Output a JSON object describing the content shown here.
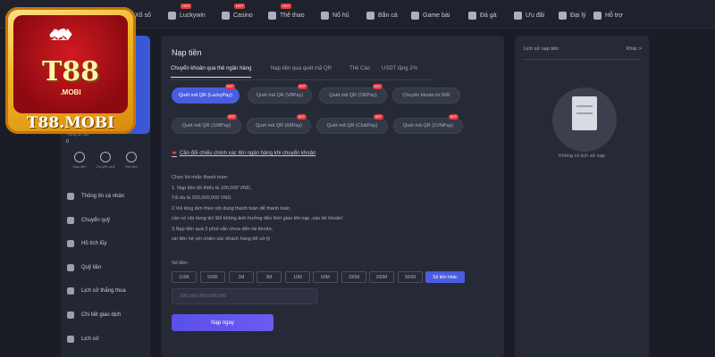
{
  "nav": [
    {
      "label": "Xổ số",
      "icon": "lottery-icon",
      "hot": ""
    },
    {
      "label": "Luckywin",
      "icon": "lucky-icon",
      "hot": "HOT"
    },
    {
      "label": "Casino",
      "icon": "casino-icon",
      "hot": "HOT"
    },
    {
      "label": "Thể thao",
      "icon": "sports-icon",
      "hot": "HOT"
    },
    {
      "label": "Nổ hũ",
      "icon": "slots-icon",
      "hot": ""
    },
    {
      "label": "Bắn cá",
      "icon": "fishing-icon",
      "hot": ""
    },
    {
      "label": "Game bài",
      "icon": "cards-icon",
      "hot": ""
    },
    {
      "label": "Đá gà",
      "icon": "cockfight-icon",
      "hot": ""
    },
    {
      "label": "Ưu đãi",
      "icon": "gift-icon",
      "hot": ""
    },
    {
      "label": "Đại lý",
      "icon": "agent-icon",
      "hot": ""
    },
    {
      "label": "Hỗ trợ",
      "icon": "support-icon",
      "hot": ""
    }
  ],
  "logo": {
    "big": "T88",
    "small": ".MOBI",
    "name": "T88.MOBI"
  },
  "sidebar": {
    "balance_label": "Tổng số dư",
    "balance_value": "0",
    "quick": [
      {
        "label": "Nạp tiền",
        "icon": "deposit-icon"
      },
      {
        "label": "Chuyển quỹ",
        "icon": "transfer-icon"
      },
      {
        "label": "Rút tiền",
        "icon": "withdraw-icon"
      }
    ],
    "menu": [
      {
        "label": "Thông tin cá nhân",
        "icon": "user-icon"
      },
      {
        "label": "Chuyển quỹ",
        "icon": "transfer-icon"
      },
      {
        "label": "Hồ tích lũy",
        "icon": "piggy-icon"
      },
      {
        "label": "Quỹ tiền",
        "icon": "wallet-icon"
      },
      {
        "label": "Lịch sử thắng thua",
        "icon": "history-icon"
      },
      {
        "label": "Chi tiết giao dịch",
        "icon": "receipt-icon"
      },
      {
        "label": "Lịch sử",
        "icon": "clock-icon"
      }
    ]
  },
  "main": {
    "title": "Nạp tiền",
    "tabs": [
      "Chuyển khoản qua thẻ ngân hàng",
      "Nạp tiền qua quét mã QR",
      "Thẻ Cào",
      "USDT tặng 2%"
    ],
    "methods": [
      {
        "label": "Quét mã QR (LuckyPay)",
        "tag": "HOT"
      },
      {
        "label": "Quét mã QR (V8Pay)",
        "tag": "HOT"
      },
      {
        "label": "Quét mã QR (OKPay)",
        "tag": "HOT"
      },
      {
        "label": "Chuyển khoản từ 50K",
        "tag": ""
      },
      {
        "label": "Quét mã QR (168Pay)",
        "tag": "HOT"
      },
      {
        "label": "Quét mã QR (68Pay)",
        "tag": "HOT"
      },
      {
        "label": "Quét mã QR (ClubPay)",
        "tag": "HOT"
      },
      {
        "label": "Quét mã QR (1VNPay)",
        "tag": "HOT"
      }
    ],
    "notice": "Cần đối chiếu chính xác tên ngân hàng khi chuyển khoản",
    "notes": [
      "Chọn lời nhắc thanh toán:",
      "1. Nạp tiền tối thiểu là 100,000 VND,",
      "Tối đa là 300,000,000 VND.",
      "2.Vui lòng làm theo nội dung thanh toán để thanh toán,",
      "cần có nội dung tin! Để không ảnh hưởng đến thời gian khi nạp ,vào tài khoản!",
      "3.Nạp tiền quá 3 phút vẫn chưa đến tài khoản,",
      "xin liên hệ với chăm sóc khách hàng để xử lý"
    ],
    "amount_label": "Số tiền:",
    "amounts": [
      "100K",
      "500K",
      "1M",
      "3M",
      "10M",
      "50M",
      "100M",
      "200M",
      "300M"
    ],
    "other_amount": "Số tiền khác",
    "input_placeholder": "100,000-300,000,000",
    "submit_label": "Nạp ngay"
  },
  "history": {
    "title": "Lịch sử nạp tiền",
    "more": "Khác >",
    "empty": "Không có lịch sử nạp"
  }
}
